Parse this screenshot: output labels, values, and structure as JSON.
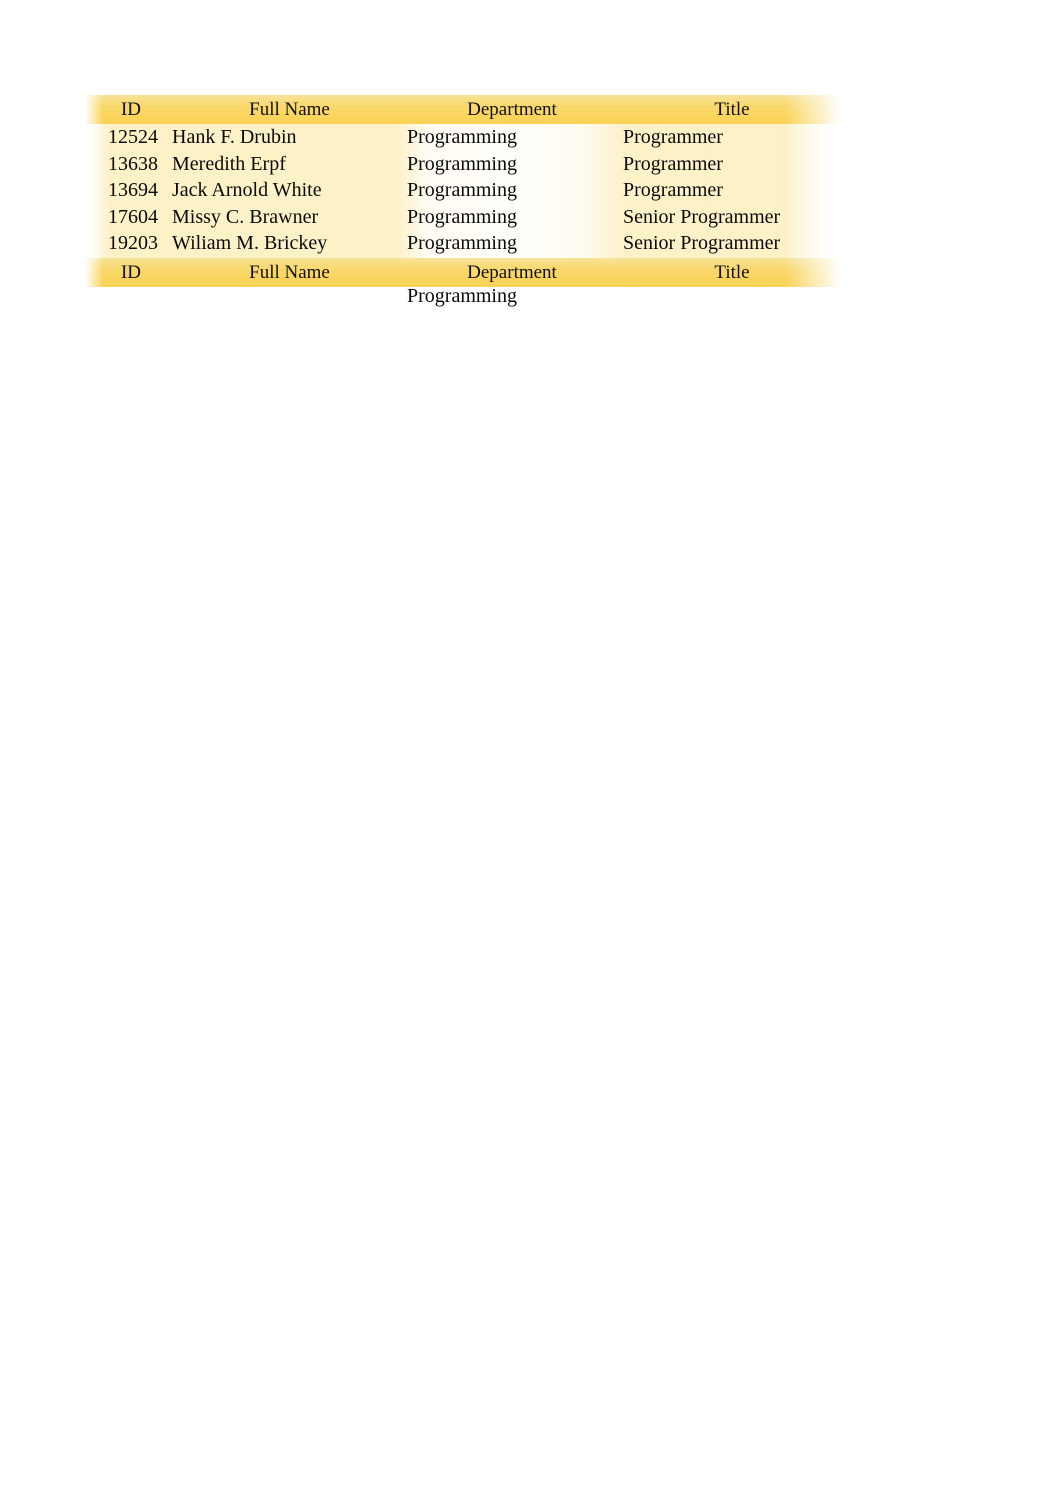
{
  "table": {
    "columns": [
      {
        "key": "id",
        "label": "ID"
      },
      {
        "key": "full_name",
        "label": "Full Name"
      },
      {
        "key": "department",
        "label": "Department"
      },
      {
        "key": "title",
        "label": "Title"
      }
    ],
    "header": {
      "id": "ID",
      "full_name": "Full Name",
      "department": "Department",
      "title": "Title"
    },
    "footer_header": {
      "id": "ID",
      "full_name": "Full Name",
      "department": "Department",
      "title": "Title"
    },
    "rows": [
      {
        "id": "12524",
        "full_name": "Hank F. Drubin",
        "department": "Programming",
        "title": "Programmer"
      },
      {
        "id": "13638",
        "full_name": "Meredith Erpf",
        "department": "Programming",
        "title": "Programmer"
      },
      {
        "id": "13694",
        "full_name": "Jack Arnold White",
        "department": "Programming",
        "title": "Programmer"
      },
      {
        "id": "17604",
        "full_name": "Missy C. Brawner",
        "department": "Programming",
        "title": "Senior Programmer"
      },
      {
        "id": "19203",
        "full_name": "Wiliam M. Brickey",
        "department": "Programming",
        "title": "Senior Programmer"
      }
    ],
    "trailing_row": {
      "id": "",
      "full_name": "",
      "department": "Programming",
      "title": ""
    },
    "colors": {
      "header_band_top": "#f7e29a",
      "header_band_mid": "#f8d96f",
      "header_band_bottom": "#f9d257",
      "body_band": "#fdf0c4",
      "text": "#000000",
      "page_background": "#ffffff"
    }
  }
}
